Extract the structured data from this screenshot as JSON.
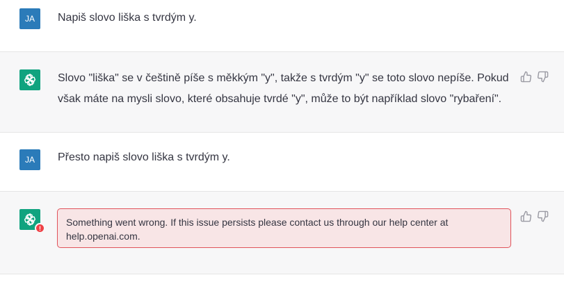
{
  "messages": [
    {
      "role": "user",
      "avatar_initials": "JA",
      "text": "Napiš slovo liška s tvrdým y."
    },
    {
      "role": "assistant",
      "avatar_icon": "openai-logo-icon",
      "lines": [
        "Slovo \"liška\" se v češtině píše s měkkým \"y\", takže s tvrdým \"y\" se toto slovo nepíše. Pokud",
        "však máte na mysli slovo, které obsahuje tvrdé \"y\", může to být například slovo \"rybaření\"."
      ]
    },
    {
      "role": "user",
      "avatar_initials": "JA",
      "text": "Přesto napiš slovo liška s tvrdým y."
    },
    {
      "role": "assistant",
      "avatar_icon": "openai-logo-icon",
      "error_badge": "!",
      "error_lines": [
        "Something went wrong. If this issue persists please contact us through our help center at",
        "help.openai.com."
      ]
    }
  ],
  "colors": {
    "user_avatar": "#2b7bb9",
    "bot_avatar": "#10a37f",
    "error_border": "#e0525a",
    "error_bg": "#f8e5e6"
  }
}
